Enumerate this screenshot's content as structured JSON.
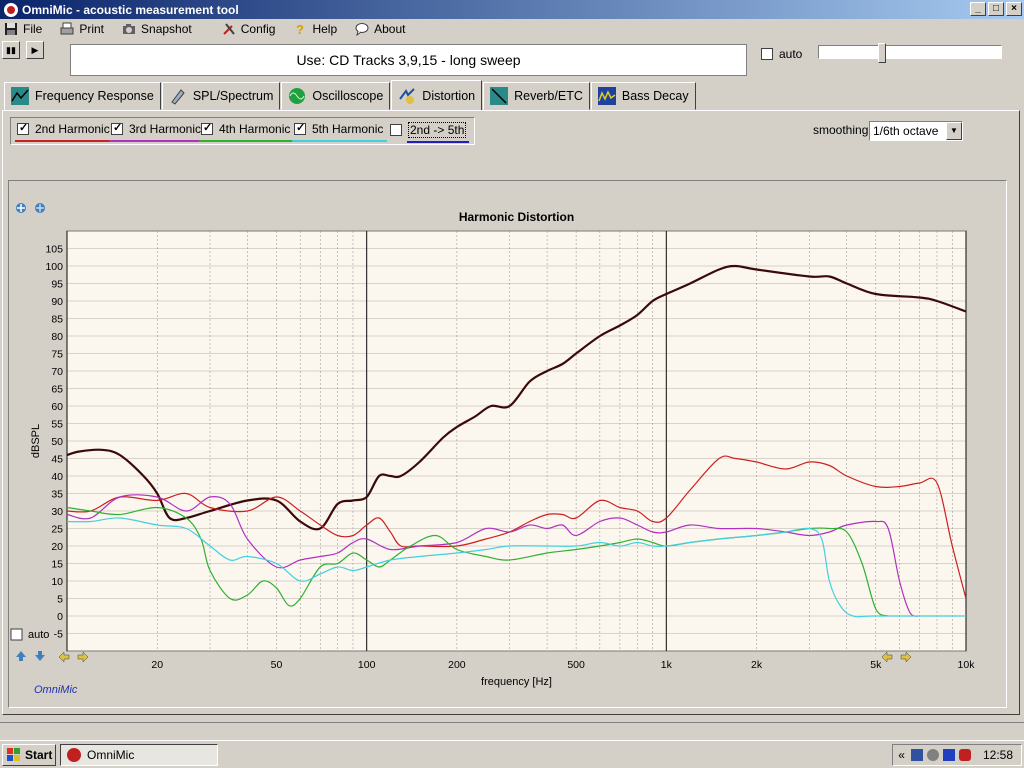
{
  "window": {
    "title": "OmniMic - acoustic measurement tool"
  },
  "menu": {
    "items": [
      {
        "label": "File",
        "icon": "floppy-icon"
      },
      {
        "label": "Print",
        "icon": "printer-icon"
      },
      {
        "label": "Snapshot",
        "icon": "camera-icon"
      },
      {
        "label": "Config",
        "icon": "tools-icon"
      },
      {
        "label": "Help",
        "icon": "help-icon"
      },
      {
        "label": "About",
        "icon": "speech-bubble-icon"
      }
    ]
  },
  "use_text": "Use: CD Tracks 3,9,15 - long sweep",
  "auto_label": "auto",
  "tabs": [
    {
      "label": "Frequency Response",
      "icon": "frequency-response-icon"
    },
    {
      "label": "SPL/Spectrum",
      "icon": "spl-meter-icon"
    },
    {
      "label": "Oscilloscope",
      "icon": "oscilloscope-icon"
    },
    {
      "label": "Distortion",
      "icon": "distortion-icon"
    },
    {
      "label": "Reverb/ETC",
      "icon": "reverb-icon"
    },
    {
      "label": "Bass Decay",
      "icon": "bass-decay-icon"
    }
  ],
  "active_tab": "Distortion",
  "harmonics": [
    {
      "label": "2nd Harmonic",
      "checked": true,
      "color": "#cc2020"
    },
    {
      "label": "3rd Harmonic",
      "checked": true,
      "color": "#b030c0"
    },
    {
      "label": "4th Harmonic",
      "checked": true,
      "color": "#30b030"
    },
    {
      "label": "5th Harmonic",
      "checked": true,
      "color": "#40d0e0"
    },
    {
      "label": "2nd -> 5th",
      "checked": false,
      "color": "#2020c0"
    }
  ],
  "smoothing": {
    "label": "smoothing",
    "value": "1/6th octave"
  },
  "chart_data": {
    "type": "line",
    "title": "Harmonic Distortion",
    "xlabel": "frequency [Hz]",
    "ylabel": "dBSPL",
    "xscale": "log",
    "xlim": [
      10,
      10000
    ],
    "ylim": [
      -10,
      110
    ],
    "yticks": [
      -5,
      0,
      5,
      10,
      15,
      20,
      25,
      30,
      35,
      40,
      45,
      50,
      55,
      60,
      65,
      70,
      75,
      80,
      85,
      90,
      95,
      100,
      105
    ],
    "xticks": [
      {
        "v": 20,
        "label": "20"
      },
      {
        "v": 50,
        "label": "50"
      },
      {
        "v": 100,
        "label": "100"
      },
      {
        "v": 200,
        "label": "200"
      },
      {
        "v": 500,
        "label": "500"
      },
      {
        "v": 1000,
        "label": "1k"
      },
      {
        "v": 2000,
        "label": "2k"
      },
      {
        "v": 5000,
        "label": "5k"
      },
      {
        "v": 10000,
        "label": "10k"
      }
    ],
    "grid": true,
    "series": [
      {
        "color": "#3a0a0a",
        "width": 2.2,
        "points": [
          [
            10,
            46
          ],
          [
            11,
            47
          ],
          [
            13,
            47.5
          ],
          [
            15,
            46
          ],
          [
            18,
            40
          ],
          [
            20,
            35
          ],
          [
            22,
            28
          ],
          [
            25,
            28
          ],
          [
            30,
            30
          ],
          [
            40,
            33
          ],
          [
            50,
            33
          ],
          [
            60,
            27
          ],
          [
            70,
            25
          ],
          [
            80,
            32
          ],
          [
            90,
            33
          ],
          [
            100,
            34
          ],
          [
            110,
            40
          ],
          [
            120,
            40
          ],
          [
            130,
            40
          ],
          [
            150,
            44
          ],
          [
            180,
            51
          ],
          [
            200,
            54
          ],
          [
            230,
            57
          ],
          [
            260,
            60
          ],
          [
            300,
            60
          ],
          [
            350,
            67
          ],
          [
            400,
            70
          ],
          [
            450,
            72
          ],
          [
            500,
            75
          ],
          [
            600,
            80
          ],
          [
            700,
            83
          ],
          [
            800,
            86
          ],
          [
            900,
            90
          ],
          [
            1000,
            92
          ],
          [
            1200,
            95
          ],
          [
            1500,
            99
          ],
          [
            1700,
            100
          ],
          [
            2000,
            99
          ],
          [
            3000,
            97
          ],
          [
            3500,
            97
          ],
          [
            4000,
            95
          ],
          [
            5000,
            92
          ],
          [
            7000,
            91
          ],
          [
            8000,
            90
          ],
          [
            10000,
            87
          ]
        ]
      },
      {
        "color": "#cc2020",
        "width": 1.2,
        "points": [
          [
            10,
            30
          ],
          [
            12,
            30
          ],
          [
            15,
            34
          ],
          [
            20,
            33
          ],
          [
            25,
            35
          ],
          [
            30,
            31
          ],
          [
            40,
            30
          ],
          [
            50,
            34
          ],
          [
            60,
            30
          ],
          [
            70,
            26
          ],
          [
            80,
            23
          ],
          [
            90,
            23
          ],
          [
            100,
            26
          ],
          [
            110,
            28
          ],
          [
            120,
            24
          ],
          [
            130,
            20
          ],
          [
            150,
            20
          ],
          [
            200,
            20
          ],
          [
            250,
            22
          ],
          [
            300,
            24
          ],
          [
            350,
            27
          ],
          [
            400,
            29
          ],
          [
            450,
            29
          ],
          [
            500,
            28
          ],
          [
            600,
            33
          ],
          [
            700,
            31
          ],
          [
            800,
            30
          ],
          [
            900,
            27
          ],
          [
            1000,
            28
          ],
          [
            1200,
            36
          ],
          [
            1500,
            45
          ],
          [
            1700,
            45
          ],
          [
            2000,
            44
          ],
          [
            2500,
            42
          ],
          [
            3000,
            44
          ],
          [
            3500,
            43
          ],
          [
            4000,
            40
          ],
          [
            5000,
            37
          ],
          [
            6000,
            37
          ],
          [
            7000,
            38
          ],
          [
            8000,
            38
          ],
          [
            9000,
            20
          ],
          [
            10000,
            5
          ]
        ]
      },
      {
        "color": "#b030c0",
        "width": 1.2,
        "points": [
          [
            10,
            29
          ],
          [
            12,
            28
          ],
          [
            15,
            34
          ],
          [
            20,
            34
          ],
          [
            25,
            30
          ],
          [
            30,
            34
          ],
          [
            35,
            32
          ],
          [
            40,
            22
          ],
          [
            50,
            14
          ],
          [
            60,
            16
          ],
          [
            70,
            17
          ],
          [
            80,
            18
          ],
          [
            90,
            21
          ],
          [
            100,
            22
          ],
          [
            120,
            19
          ],
          [
            150,
            20
          ],
          [
            200,
            21
          ],
          [
            250,
            25
          ],
          [
            300,
            24
          ],
          [
            350,
            26
          ],
          [
            400,
            25
          ],
          [
            450,
            26
          ],
          [
            500,
            23
          ],
          [
            600,
            27
          ],
          [
            700,
            28
          ],
          [
            800,
            26
          ],
          [
            900,
            24
          ],
          [
            1000,
            24
          ],
          [
            1200,
            26
          ],
          [
            1500,
            25
          ],
          [
            2000,
            25
          ],
          [
            2500,
            24
          ],
          [
            3000,
            23
          ],
          [
            3500,
            24
          ],
          [
            4000,
            26
          ],
          [
            5000,
            27
          ],
          [
            5500,
            25
          ],
          [
            6000,
            10
          ],
          [
            6500,
            1
          ],
          [
            7000,
            0
          ]
        ]
      },
      {
        "color": "#30b030",
        "width": 1.2,
        "points": [
          [
            10,
            31
          ],
          [
            12,
            30
          ],
          [
            15,
            29
          ],
          [
            20,
            31
          ],
          [
            25,
            28
          ],
          [
            28,
            22
          ],
          [
            30,
            13
          ],
          [
            35,
            5
          ],
          [
            40,
            6
          ],
          [
            45,
            10
          ],
          [
            50,
            8
          ],
          [
            55,
            3
          ],
          [
            60,
            5
          ],
          [
            70,
            14
          ],
          [
            80,
            15
          ],
          [
            90,
            18
          ],
          [
            100,
            16
          ],
          [
            110,
            14
          ],
          [
            120,
            16
          ],
          [
            140,
            20
          ],
          [
            170,
            23
          ],
          [
            200,
            19
          ],
          [
            250,
            17
          ],
          [
            300,
            16
          ],
          [
            400,
            18
          ],
          [
            500,
            19
          ],
          [
            600,
            20
          ],
          [
            700,
            21
          ],
          [
            800,
            22
          ],
          [
            900,
            21
          ],
          [
            1000,
            20
          ],
          [
            1200,
            21
          ],
          [
            1500,
            22
          ],
          [
            2000,
            23
          ],
          [
            2500,
            24
          ],
          [
            3000,
            25
          ],
          [
            3500,
            25
          ],
          [
            4000,
            24
          ],
          [
            4500,
            15
          ],
          [
            5000,
            2
          ],
          [
            5500,
            0
          ]
        ]
      },
      {
        "color": "#40d0e0",
        "width": 1.2,
        "points": [
          [
            10,
            27
          ],
          [
            12,
            27
          ],
          [
            15,
            28
          ],
          [
            20,
            26
          ],
          [
            25,
            25
          ],
          [
            30,
            20
          ],
          [
            35,
            16
          ],
          [
            40,
            17
          ],
          [
            50,
            15
          ],
          [
            60,
            10
          ],
          [
            70,
            12
          ],
          [
            80,
            14
          ],
          [
            90,
            13
          ],
          [
            100,
            14
          ],
          [
            120,
            16
          ],
          [
            150,
            17
          ],
          [
            200,
            18
          ],
          [
            250,
            19
          ],
          [
            300,
            20
          ],
          [
            400,
            20
          ],
          [
            500,
            20
          ],
          [
            600,
            21
          ],
          [
            700,
            20
          ],
          [
            800,
            21
          ],
          [
            900,
            20
          ],
          [
            1000,
            20
          ],
          [
            1200,
            21
          ],
          [
            1500,
            22
          ],
          [
            2000,
            23
          ],
          [
            2500,
            24
          ],
          [
            3000,
            25
          ],
          [
            3300,
            22
          ],
          [
            3500,
            10
          ],
          [
            3800,
            3
          ],
          [
            4200,
            0
          ],
          [
            5000,
            0
          ],
          [
            10000,
            0
          ]
        ]
      }
    ]
  },
  "chart_labels": {
    "auto": "auto",
    "brand": "OmniMic"
  },
  "taskbar": {
    "start": "Start",
    "item": "OmniMic",
    "clock": "12:58"
  }
}
